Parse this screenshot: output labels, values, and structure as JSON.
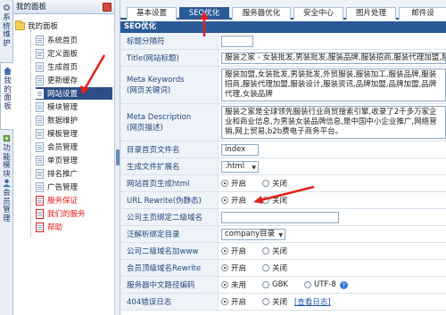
{
  "colors": {
    "accent": "#2b5a98",
    "selected": "#2b4f86",
    "highlight_red": "#e0201a",
    "label_bg": "#eef3f9"
  },
  "vtabs": [
    {
      "label": "系统维护",
      "icon": "gear-icon"
    },
    {
      "label": "我的面板",
      "icon": "home-icon"
    },
    {
      "label": "功能模块",
      "icon": "plugin-icon"
    },
    {
      "label": "会员管理",
      "icon": "user-icon"
    }
  ],
  "tree": {
    "title": "我的面板",
    "root": "我的面板",
    "items": [
      {
        "label": "系统首页"
      },
      {
        "label": "定义面板"
      },
      {
        "label": "生成首页"
      },
      {
        "label": "更新缓存"
      },
      {
        "label": "网站设置"
      },
      {
        "label": "模块管理"
      },
      {
        "label": "数据维护"
      },
      {
        "label": "模板管理"
      },
      {
        "label": "会员管理"
      },
      {
        "label": "单页管理"
      },
      {
        "label": "排名推广"
      },
      {
        "label": "广告管理"
      },
      {
        "label": "服务保证"
      },
      {
        "label": "我们的服务"
      },
      {
        "label": "帮助"
      }
    ]
  },
  "tabs": [
    "基本设置",
    "SEO优化",
    "服务器优化",
    "安全中心",
    "图片处理",
    "邮件设"
  ],
  "section_title": "SEO优化",
  "form": {
    "separator": {
      "label": "标题分隔符",
      "value": ""
    },
    "title": {
      "label": "Title(网站标题)",
      "value": "服装之家 - 女装批发,男装批发,服装品牌,服装招商,服装代理加盟,服装"
    },
    "keywords": {
      "label1": "Meta Keywords",
      "label2": "(网页关键词)",
      "value": "服装加盟,女装批发,男装批发,外贸服装,服装加工,服装品牌,服装招商,服装代理加盟,服装设计,服装资讯,品牌加盟,品牌加盟,品牌代理,女装品牌"
    },
    "description": {
      "label1": "Meta Description",
      "label2": "(网页描述)",
      "value": "服装之家是全球领先服装行业商贸搜索引擎,收录了2千多万家企业和商业信息,为男装女装品牌信息,是中国中小企业推广,网络营销,网上贸易,b2b费电子商务平台。"
    },
    "index_name": {
      "label": "目录首页文件名",
      "value": "index"
    },
    "ext": {
      "label": "生成文件扩展名",
      "value": ".html"
    },
    "html_home": {
      "label": "网站首页生成html",
      "opt_on": "开启",
      "opt_off": "关闭"
    },
    "rewrite": {
      "label": "URL Rewrite(伪静态)",
      "opt_on": "开启",
      "opt_off": "关闭"
    },
    "main_domain": {
      "label": "公司主页绑定二级域名",
      "value": ""
    },
    "pan_dir": {
      "label": "泛解析绑定目录",
      "value": "company目录"
    },
    "company_www": {
      "label": "公司二级域名加www",
      "opt_on": "开启",
      "opt_off": "关闭"
    },
    "member_rewrite": {
      "label": "会员顶级域名Rewrite",
      "opt_on": "开启",
      "opt_off": "关闭"
    },
    "encoding": {
      "label": "服务器中文路径编码",
      "opt_none": "未用",
      "opt_gbk": "GBK",
      "opt_utf8": "UTF-8"
    },
    "log404": {
      "label": "404错误日志",
      "opt_on": "开启",
      "opt_off": "关闭",
      "link": "[查看日志]"
    }
  }
}
